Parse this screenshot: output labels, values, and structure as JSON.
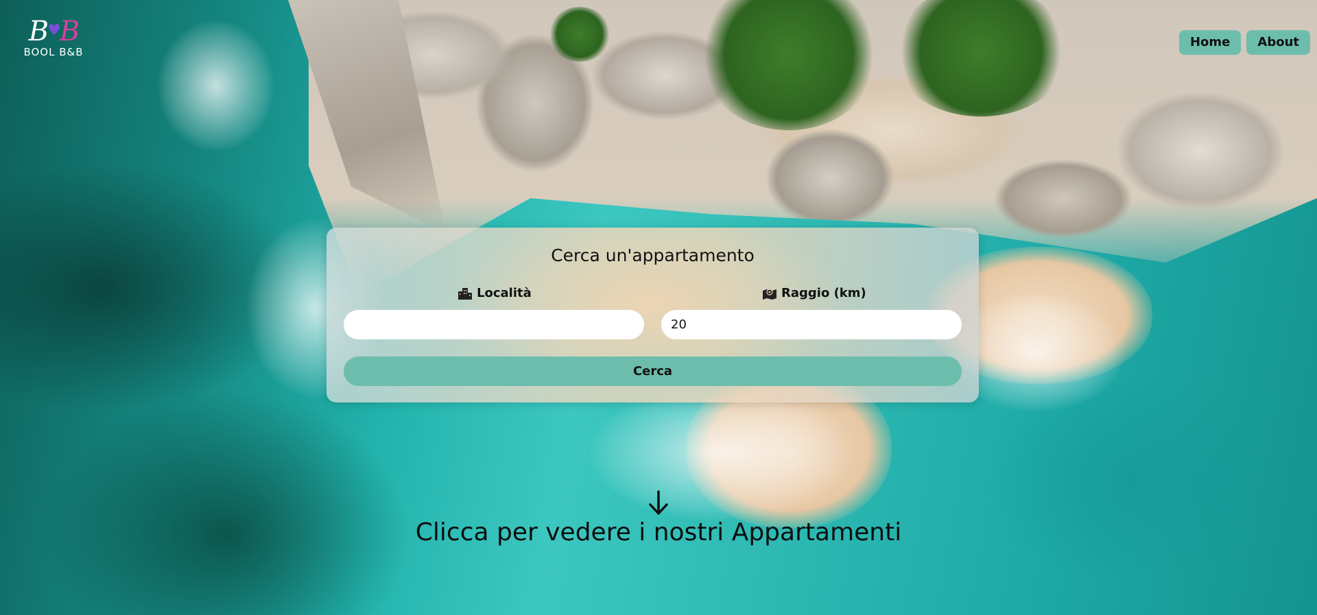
{
  "brand": {
    "logo_mark_b1": "B",
    "logo_mark_b2": "B",
    "logo_text": "BOOL B&B",
    "colors": {
      "white": "#ffffff",
      "pink": "#d63fa0",
      "purple": "#7a4fd6"
    }
  },
  "nav": {
    "items": [
      {
        "label": "Home"
      },
      {
        "label": "About"
      }
    ],
    "button_color": "#6dbdac"
  },
  "search": {
    "title": "Cerca un'appartamento",
    "location": {
      "label": "Località",
      "icon": "city-icon",
      "value": "",
      "placeholder": ""
    },
    "radius": {
      "label": "Raggio (km)",
      "icon": "map-location-icon",
      "value": "20"
    },
    "submit_label": "Cerca",
    "accent": "#6dbdac"
  },
  "cta": {
    "icon": "arrow-down-icon",
    "text": "Clicca per vedere i nostri Appartamenti"
  }
}
